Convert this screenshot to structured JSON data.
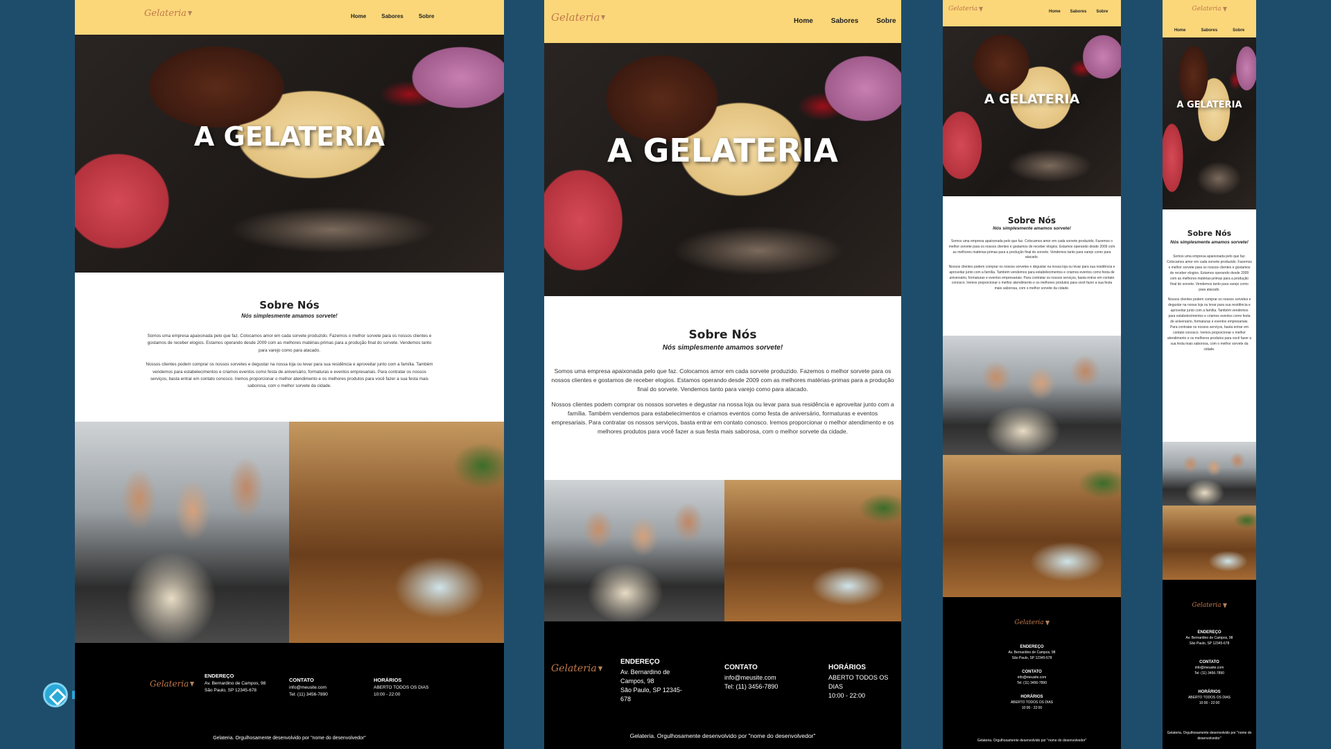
{
  "site": {
    "logo_text": "Gelateria",
    "nav": [
      "Home",
      "Sabores",
      "Sobre"
    ],
    "hero_title": "A GELATERIA",
    "about": {
      "heading": "Sobre Nós",
      "tagline": "Nós simplesmente amamos sorvete!",
      "p1": "Somos uma empresa apaixonada pelo que faz. Colocamos amor em cada sorvete produzido. Fazemos o melhor sorvete para os nossos clientes e gostamos de receber elogios. Estamos operando desde 2009 com as melhores matérias-primas para a produção final do sorvete. Vendemos tanto para varejo como para atacado.",
      "p2": "Nossos clientes podem comprar os nossos sorvetes e degustar na nossa loja ou levar para sua residência e aproveitar junto com a família. Também vendemos para estabelecimentos e criamos eventos como festa de aniversário, formaturas e eventos empresariais. Para contratar os nossos serviços, basta entrar em contato conosco. Iremos proporcionar o melhor atendimento e os melhores produtos para você fazer a sua festa mais saborosa, com o melhor sorvete da cidade."
    },
    "footer": {
      "address_title": "ENDEREÇO",
      "address_line1": "Av. Bernardino de Campos, 98",
      "address_line2": "São Paulo, SP 12345-678",
      "contact_title": "CONTATO",
      "email": "info@meusite.com",
      "phone": "Tel: (11) 3456-7890",
      "hours_title": "HORÁRIOS",
      "hours_line1": "ABERTO TODOS OS DIAS",
      "hours_line2": "10:00 - 22:00",
      "credit": "Gelateria. Orgulhosamente desenvolvido por \"nome do desenvolvedor\""
    }
  },
  "colors": {
    "page_bg": "#1e4d6b",
    "nav_bg": "#fbd77a",
    "footer_bg": "#000000",
    "logo": "#c0784a"
  },
  "icons": [
    "ice-cream-cone-icon",
    "brand-badge-icon"
  ]
}
